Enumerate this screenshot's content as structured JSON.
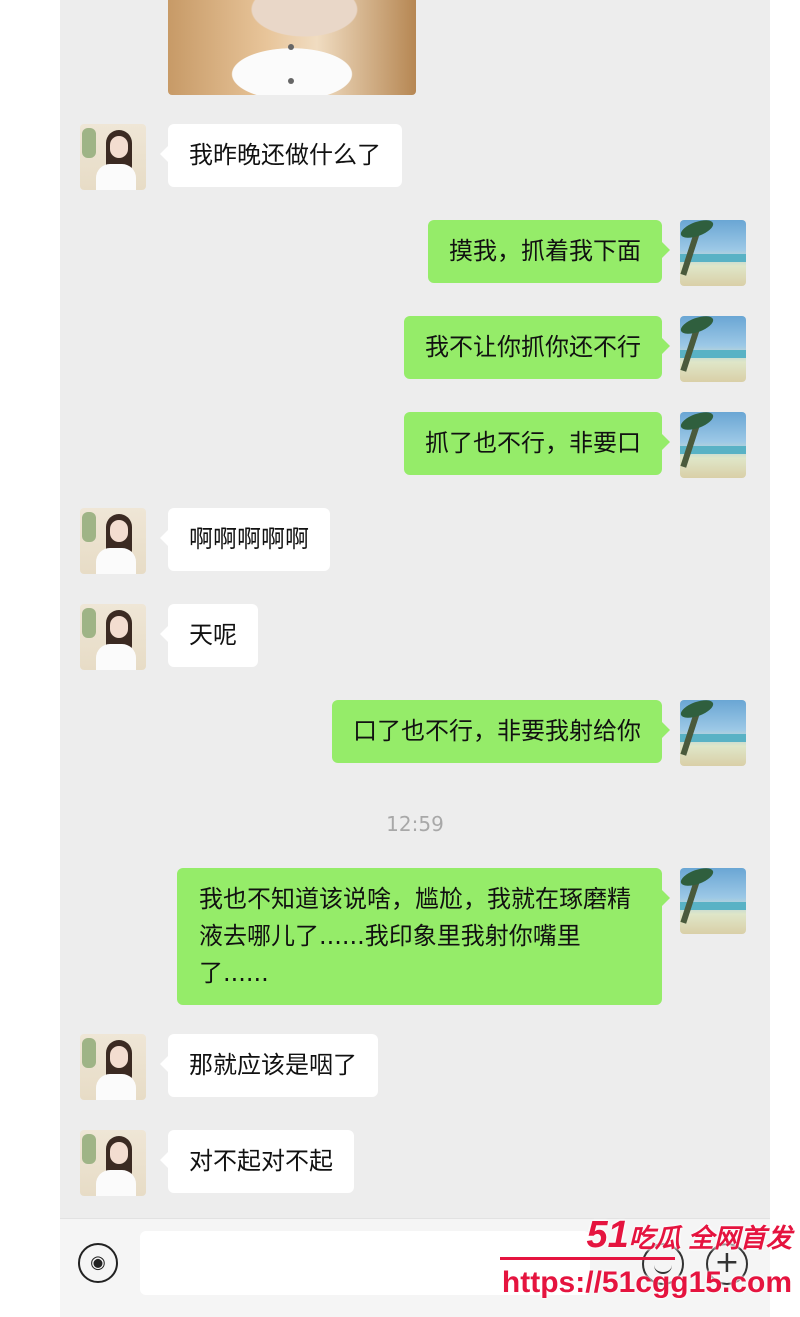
{
  "messages": [
    {
      "from": "them",
      "text": "我昨晚还做什么了"
    },
    {
      "from": "me",
      "text": "摸我，抓着我下面"
    },
    {
      "from": "me",
      "text": "我不让你抓你还不行"
    },
    {
      "from": "me",
      "text": "抓了也不行，非要口"
    },
    {
      "from": "them",
      "text": "啊啊啊啊啊"
    },
    {
      "from": "them",
      "text": "天呢"
    },
    {
      "from": "me",
      "text": "口了也不行，非要我射给你"
    },
    {
      "from": "me",
      "text": "我也不知道该说啥，尴尬，我就在琢磨精液去哪儿了......我印象里我射你嘴里了......"
    },
    {
      "from": "them",
      "text": "那就应该是咽了"
    },
    {
      "from": "them",
      "text": "对不起对不起"
    }
  ],
  "timestamp": "12:59",
  "input_bar": {
    "voice_icon": "voice-icon",
    "emoji_icon": "emoji-icon",
    "plus_icon": "plus-icon"
  },
  "watermark": {
    "brand_num": "51",
    "brand_text": "吃瓜 全网首发",
    "url": "https://51cgg15.com"
  },
  "colors": {
    "outgoing": "#95ec69",
    "incoming": "#ffffff",
    "background": "#ededed",
    "watermark": "#e5143f"
  }
}
